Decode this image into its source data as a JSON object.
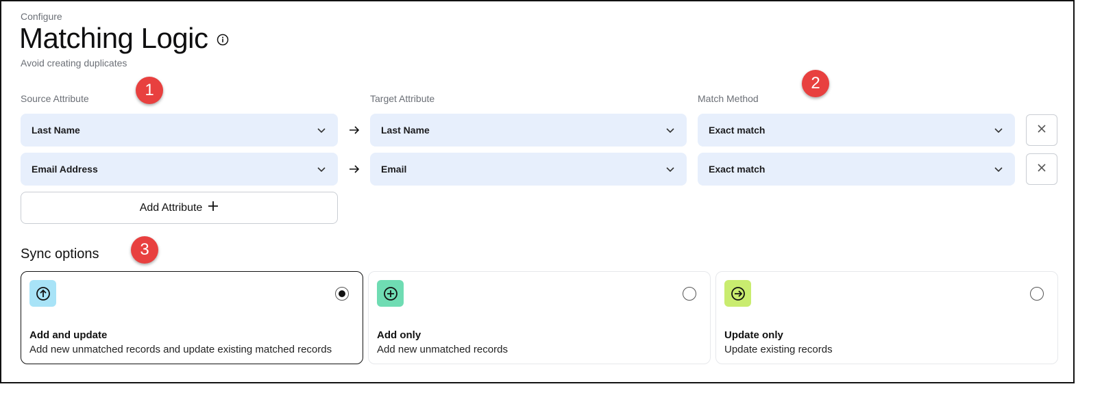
{
  "header": {
    "eyebrow": "Configure",
    "title": "Matching Logic",
    "subtitle": "Avoid creating duplicates",
    "info_icon": "info-circle-icon"
  },
  "columns": {
    "source": "Source Attribute",
    "target": "Target Attribute",
    "method": "Match Method"
  },
  "rows": [
    {
      "source": "Last Name",
      "target": "Last Name",
      "method": "Exact match"
    },
    {
      "source": "Email Address",
      "target": "Email",
      "method": "Exact match"
    }
  ],
  "add_attribute": {
    "label": "Add Attribute",
    "icon": "plus-icon"
  },
  "sync": {
    "title": "Sync options",
    "options": [
      {
        "title": "Add and update",
        "description": "Add new unmatched records and update existing matched records",
        "icon": "arrow-up-circle-icon",
        "color": "#a8e3f7",
        "selected": true
      },
      {
        "title": "Add only",
        "description": "Add new unmatched records",
        "icon": "plus-circle-icon",
        "color": "#6fdcb3",
        "selected": false
      },
      {
        "title": "Update only",
        "description": "Update existing records",
        "icon": "arrow-right-circle-icon",
        "color": "#c9ec6f",
        "selected": false
      }
    ]
  },
  "markers": [
    "1",
    "2",
    "3"
  ],
  "colors": {
    "select_bg": "#e7effc",
    "marker": "#e8403f",
    "muted_text": "#6b6f76"
  }
}
